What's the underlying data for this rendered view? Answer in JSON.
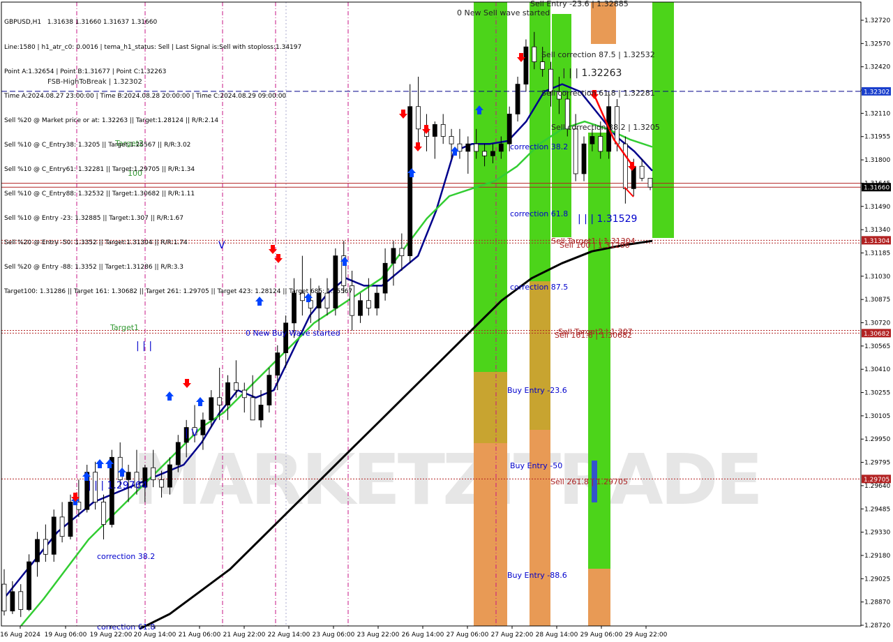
{
  "header": {
    "lines": [
      "GBPUSD,H1   1.31638 1.31660 1.31637 1.31660",
      "Line:1580 | h1_atr_c0: 0.0016 | tema_h1_status: Sell | Last Signal is:Sell with stoploss:1.34197",
      "Point A:1.32654 | Point B:1.31677 | Point C:1.32263",
      "Time A:2024.08.27 23:00:00 | Time B:2024.08.28 20:00:00 | Time C:2024.08.29 09:00:00",
      "Sell %20 @ Market price or at: 1.32263 || Target:1.28124 || R/R:2.14",
      "Sell %10 @ C_Entry38: 1.3205 || Target:1.25567 || R/R:3.02",
      "Sell %10 @ C_Entry61: 1.32281 || Target:1.29705 || R/R:1.34",
      "Sell %10 @ C_Entry88: 1.32532 || Target:1.30682 || R/R:1.11",
      "Sell %10 @ Entry -23: 1.32885 || Target:1.307 || R/R:1.67",
      "Sell %20 @ Entry -50: 1.3352 || Target:1.31304 || R/R:1.74",
      "Sell %20 @ Entry -88: 1.3352 || Target:1.31286 || R/R:3.3",
      "Target100: 1.31286 || Target 161: 1.30682 || Target 261: 1.29705 || Target 423: 1.28124 || Target 685: 1.25567"
    ]
  },
  "watermark": "MARKETZITRADE",
  "colors": {
    "background": "#ffffff",
    "bull_bar": "#000000",
    "blue_ma": "#00008b",
    "green_ma": "#32cd32",
    "black_ma": "#000000",
    "red_level": "#b22222",
    "blue_level": "#00008b",
    "zone_green": "#4cd41a",
    "zone_orange": "#e89a55",
    "zone_olive": "#c8a430",
    "signal_red": "#ff0000",
    "signal_blue": "#0044ff",
    "vline": "#c71585",
    "label_blue": "#0000cc",
    "label_red": "#aa2222",
    "label_green": "#339933"
  },
  "chart_data": {
    "type": "candlestick",
    "symbol": "GBPUSD",
    "timeframe": "H1",
    "ylim": [
      1.2872,
      1.329
    ],
    "y_ticks": [
      "1.32720",
      "1.32570",
      "1.32420",
      "1.32265",
      "1.32110",
      "1.31955",
      "1.31800",
      "1.31645",
      "1.31490",
      "1.31340",
      "1.31185",
      "1.31030",
      "1.30875",
      "1.30720",
      "1.30565",
      "1.30410",
      "1.30255",
      "1.30105",
      "1.29950",
      "1.29795",
      "1.29640",
      "1.29485",
      "1.29330",
      "1.29180",
      "1.29025",
      "1.28870",
      "1.28720"
    ],
    "x_tick_labels": [
      "16 Aug 2024",
      "19 Aug 06:00",
      "19 Aug 22:00",
      "20 Aug 14:00",
      "21 Aug 06:00",
      "21 Aug 22:00",
      "22 Aug 14:00",
      "23 Aug 06:00",
      "23 Aug 22:00",
      "26 Aug 14:00",
      "27 Aug 06:00",
      "27 Aug 22:00",
      "28 Aug 14:00",
      "29 Aug 06:00",
      "29 Aug 22:00"
    ],
    "price_tags": [
      {
        "value": 1.32302,
        "label": "1.32302",
        "color": "blue"
      },
      {
        "value": 1.3166,
        "label": "1.31660",
        "color": "black"
      },
      {
        "value": 1.31304,
        "label": "1.31304",
        "color": "red"
      },
      {
        "value": 1.30682,
        "label": "1.30682",
        "color": "red"
      },
      {
        "value": 1.29705,
        "label": "1.29705",
        "color": "red"
      }
    ],
    "horizontal_levels": [
      {
        "value": 1.32302,
        "style": "dashed",
        "color": "blue"
      },
      {
        "value": 1.31686,
        "style": "solid",
        "color": "red"
      },
      {
        "value": 1.3166,
        "style": "solid",
        "color": "red"
      },
      {
        "value": 1.31304,
        "style": "dotted",
        "color": "red"
      },
      {
        "value": 1.31286,
        "style": "dotted",
        "color": "red"
      },
      {
        "value": 1.307,
        "style": "dotted",
        "color": "red"
      },
      {
        "value": 1.30682,
        "style": "dotted",
        "color": "red"
      },
      {
        "value": 1.29705,
        "style": "dotted",
        "color": "red"
      }
    ],
    "annotations": [
      {
        "text": "0 New Sell wave started",
        "color": "black"
      },
      {
        "text": "Sell Entry -23.6 | 1.32885",
        "color": "black"
      },
      {
        "text": "Sell correction 87.5 | 1.32532",
        "color": "black"
      },
      {
        "text": "| | | 1.32263",
        "color": "black"
      },
      {
        "text": "Sell correction 61.8 | 1.32281",
        "color": "black"
      },
      {
        "text": "Sell correction 38.2 | 1.3205",
        "color": "black"
      },
      {
        "text": "Target2",
        "color": "green"
      },
      {
        "text": "100",
        "color": "green"
      },
      {
        "text": "correction 38.2",
        "color": "blue"
      },
      {
        "text": "correction 61.8",
        "color": "blue"
      },
      {
        "text": "| | | 1.31529",
        "color": "blue"
      },
      {
        "text": "Sell Target1 | 1.31304",
        "color": "red"
      },
      {
        "text": "Sell 100 | 1.31286",
        "color": "red"
      },
      {
        "text": "correction 87.5",
        "color": "blue"
      },
      {
        "text": "Target1",
        "color": "green"
      },
      {
        "text": "0 New Buy Wave started",
        "color": "blue"
      },
      {
        "text": "Sell Target2 | 1.307",
        "color": "red"
      },
      {
        "text": "Sell 161.8 | 1.30682",
        "color": "red"
      },
      {
        "text": "| | |",
        "color": "blue"
      },
      {
        "text": "Buy Entry -23.6",
        "color": "blue"
      },
      {
        "text": "Buy Entry -50",
        "color": "blue"
      },
      {
        "text": "Sell 261.8 | 1.29705",
        "color": "red"
      },
      {
        "text": "| | | 1.29764",
        "color": "blue"
      },
      {
        "text": "correction 38.2",
        "color": "blue"
      },
      {
        "text": "correction 61.8",
        "color": "blue"
      },
      {
        "text": "Buy Entry -88.6",
        "color": "blue"
      },
      {
        "text": "FSB-HighToBreak | 1.32302",
        "color": "black"
      },
      {
        "text": "V",
        "color": "blue"
      },
      {
        "text": "| V",
        "color": "blue"
      }
    ],
    "candles": [
      [
        1.29,
        1.291,
        1.2879,
        1.2882
      ],
      [
        1.2882,
        1.2902,
        1.288,
        1.2895
      ],
      [
        1.2895,
        1.29,
        1.2878,
        1.2883
      ],
      [
        1.2883,
        1.292,
        1.2882,
        1.2915
      ],
      [
        1.2915,
        1.2935,
        1.2905,
        1.293
      ],
      [
        1.293,
        1.294,
        1.2915,
        1.292
      ],
      [
        1.292,
        1.295,
        1.2915,
        1.2945
      ],
      [
        1.2945,
        1.2955,
        1.2928,
        1.2932
      ],
      [
        1.2932,
        1.296,
        1.293,
        1.2955
      ],
      [
        1.2955,
        1.297,
        1.2945,
        1.295
      ],
      [
        1.295,
        1.298,
        1.2948,
        1.2975
      ],
      [
        1.2975,
        1.2982,
        1.295,
        1.2955
      ],
      [
        1.2955,
        1.296,
        1.293,
        1.294
      ],
      [
        1.294,
        1.299,
        1.2938,
        1.2985
      ],
      [
        1.2985,
        1.2995,
        1.2965,
        1.297
      ],
      [
        1.297,
        1.298,
        1.2955,
        1.2975
      ],
      [
        1.2975,
        1.299,
        1.296,
        1.2965
      ],
      [
        1.2965,
        1.298,
        1.2955,
        1.2978
      ],
      [
        1.2978,
        1.299,
        1.2965,
        1.297
      ],
      [
        1.297,
        1.2976,
        1.2958,
        1.2965
      ],
      [
        1.2965,
        1.2985,
        1.296,
        1.298
      ],
      [
        1.298,
        1.3,
        1.2975,
        1.2995
      ],
      [
        1.2995,
        1.301,
        1.2985,
        1.3005
      ],
      [
        1.3005,
        1.302,
        1.2995,
        1.3
      ],
      [
        1.3,
        1.3015,
        1.299,
        1.301
      ],
      [
        1.301,
        1.303,
        1.3005,
        1.3025
      ],
      [
        1.3025,
        1.3045,
        1.301,
        1.302
      ],
      [
        1.302,
        1.304,
        1.301,
        1.3035
      ],
      [
        1.3035,
        1.305,
        1.3025,
        1.303
      ],
      [
        1.303,
        1.3035,
        1.3015,
        1.3025
      ],
      [
        1.3025,
        1.304,
        1.3015,
        1.301
      ],
      [
        1.301,
        1.303,
        1.3005,
        1.302
      ],
      [
        1.302,
        1.3045,
        1.3015,
        1.304
      ],
      [
        1.304,
        1.306,
        1.303,
        1.3055
      ],
      [
        1.3055,
        1.308,
        1.3045,
        1.3075
      ],
      [
        1.3075,
        1.3105,
        1.3065,
        1.3095
      ],
      [
        1.3095,
        1.312,
        1.308,
        1.309
      ],
      [
        1.309,
        1.3105,
        1.3075,
        1.3085
      ],
      [
        1.3085,
        1.31,
        1.307,
        1.3095
      ],
      [
        1.3095,
        1.3105,
        1.308,
        1.3085
      ],
      [
        1.3085,
        1.3125,
        1.308,
        1.312
      ],
      [
        1.312,
        1.313,
        1.3095,
        1.31
      ],
      [
        1.31,
        1.311,
        1.307,
        1.308
      ],
      [
        1.308,
        1.3095,
        1.3075,
        1.309
      ],
      [
        1.309,
        1.3105,
        1.308,
        1.3085
      ],
      [
        1.3085,
        1.31,
        1.308,
        1.3095
      ],
      [
        1.3095,
        1.3125,
        1.309,
        1.3115
      ],
      [
        1.3115,
        1.313,
        1.31,
        1.3125
      ],
      [
        1.3125,
        1.3135,
        1.311,
        1.312
      ],
      [
        1.312,
        1.3235,
        1.3115,
        1.322
      ],
      [
        1.322,
        1.324,
        1.3195,
        1.3205
      ],
      [
        1.3205,
        1.3215,
        1.319,
        1.32
      ],
      [
        1.32,
        1.321,
        1.3185,
        1.3208
      ],
      [
        1.3208,
        1.3215,
        1.3195,
        1.32
      ],
      [
        1.32,
        1.3205,
        1.3185,
        1.3195
      ],
      [
        1.3195,
        1.3205,
        1.3185,
        1.319
      ],
      [
        1.319,
        1.32,
        1.3175,
        1.3195
      ],
      [
        1.3195,
        1.3205,
        1.3185,
        1.319
      ],
      [
        1.319,
        1.3195,
        1.318,
        1.3187
      ],
      [
        1.3187,
        1.3195,
        1.3182,
        1.319
      ],
      [
        1.319,
        1.32,
        1.3185,
        1.3195
      ],
      [
        1.3195,
        1.322,
        1.319,
        1.3215
      ],
      [
        1.3215,
        1.324,
        1.321,
        1.3235
      ],
      [
        1.3235,
        1.3265,
        1.323,
        1.326
      ],
      [
        1.326,
        1.327,
        1.3245,
        1.325
      ],
      [
        1.325,
        1.326,
        1.324,
        1.3245
      ],
      [
        1.3245,
        1.325,
        1.322,
        1.323
      ],
      [
        1.323,
        1.324,
        1.3215,
        1.3225
      ],
      [
        1.3225,
        1.323,
        1.32,
        1.3205
      ],
      [
        1.3205,
        1.3215,
        1.317,
        1.3175
      ],
      [
        1.3175,
        1.32,
        1.317,
        1.3195
      ],
      [
        1.3195,
        1.3205,
        1.319,
        1.32
      ],
      [
        1.32,
        1.321,
        1.3185,
        1.319
      ],
      [
        1.319,
        1.323,
        1.3185,
        1.322
      ],
      [
        1.322,
        1.3225,
        1.319,
        1.3195
      ],
      [
        1.3195,
        1.32,
        1.3155,
        1.3165
      ],
      [
        1.3165,
        1.3185,
        1.316,
        1.318
      ],
      [
        1.318,
        1.3185,
        1.317,
        1.3172
      ],
      [
        1.3172,
        1.317,
        1.3164,
        1.3166
      ]
    ],
    "moving_averages": [
      {
        "color": "navy",
        "values": [
          1.289,
          1.2905,
          1.292,
          1.2935,
          1.2945,
          1.2955,
          1.296,
          1.2965,
          1.297,
          1.2975,
          1.298,
          1.2995,
          1.3015,
          1.303,
          1.3025,
          1.303,
          1.3055,
          1.308,
          1.3095,
          1.3105,
          1.31,
          1.31,
          1.311,
          1.312,
          1.315,
          1.319,
          1.3195,
          1.3195,
          1.3197,
          1.321,
          1.323,
          1.3235,
          1.323,
          1.3215,
          1.32,
          1.319,
          1.3177
        ]
      },
      {
        "color": "limegreen",
        "values": [
          1.2872,
          1.289,
          1.291,
          1.293,
          1.2945,
          1.296,
          1.2975,
          1.299,
          1.3005,
          1.3015,
          1.303,
          1.3045,
          1.306,
          1.3075,
          1.3085,
          1.3095,
          1.3105,
          1.3125,
          1.3145,
          1.316,
          1.3165,
          1.317,
          1.318,
          1.3195,
          1.3205,
          1.321,
          1.3205,
          1.3198,
          1.3193
        ]
      },
      {
        "color": "black",
        "values": [
          1.287,
          1.288,
          1.2895,
          1.291,
          1.293,
          1.295,
          1.297,
          1.299,
          1.301,
          1.303,
          1.305,
          1.307,
          1.309,
          1.3105,
          1.3115,
          1.3123,
          1.3127,
          1.313
        ]
      }
    ]
  }
}
